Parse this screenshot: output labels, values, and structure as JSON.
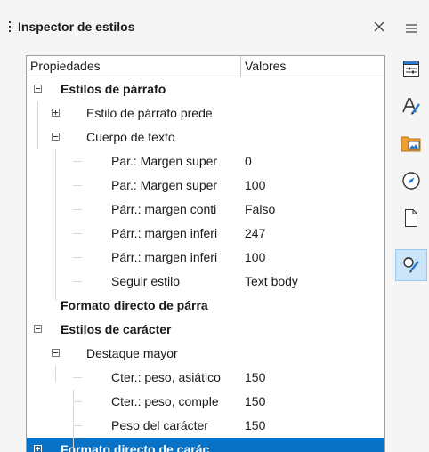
{
  "panel": {
    "title": "Inspector de estilos",
    "close_label": "Cerrar"
  },
  "tree": {
    "columns": [
      "Propiedades",
      "Valores"
    ],
    "rows": [
      {
        "label": "Estilos de párrafo",
        "value": "",
        "level": 0,
        "expander": "minus",
        "bold": true
      },
      {
        "label": "Estilo de párrafo prede",
        "value": "",
        "level": 1,
        "expander": "plus",
        "bold": false
      },
      {
        "label": "Cuerpo de texto",
        "value": "",
        "level": 1,
        "expander": "minus",
        "bold": false
      },
      {
        "label": "Par.: Margen super",
        "value": "0",
        "level": 2,
        "expander": "none",
        "bold": false
      },
      {
        "label": "Par.: Margen super",
        "value": "100",
        "level": 2,
        "expander": "none",
        "bold": false
      },
      {
        "label": "Párr.: margen conti",
        "value": "Falso",
        "level": 2,
        "expander": "none",
        "bold": false
      },
      {
        "label": "Párr.: margen inferi",
        "value": "247",
        "level": 2,
        "expander": "none",
        "bold": false
      },
      {
        "label": "Párr.: margen inferi",
        "value": "100",
        "level": 2,
        "expander": "none",
        "bold": false
      },
      {
        "label": "Seguir estilo",
        "value": "Text body",
        "level": 2,
        "expander": "none",
        "bold": false
      },
      {
        "label": "Formato directo de párra",
        "value": "",
        "level": 0,
        "expander": "none",
        "bold": true
      },
      {
        "label": "Estilos de carácter",
        "value": "",
        "level": 0,
        "expander": "minus",
        "bold": true
      },
      {
        "label": "Destaque mayor",
        "value": "",
        "level": 1,
        "expander": "minus",
        "bold": false
      },
      {
        "label": "Cter.: peso, asiático",
        "value": "150",
        "level": 2,
        "expander": "none",
        "bold": false
      },
      {
        "label": "Cter.: peso, comple",
        "value": "150",
        "level": 2,
        "expander": "none",
        "bold": false
      },
      {
        "label": "Peso del carácter",
        "value": "150",
        "level": 2,
        "expander": "none",
        "bold": false
      },
      {
        "label": "Formato directo de carác",
        "value": "",
        "level": 0,
        "expander": "plus",
        "bold": true,
        "selected": true
      }
    ]
  },
  "sidebar": {
    "buttons": [
      {
        "name": "sidebar-menu-button",
        "icon": "hamburger-icon",
        "active": false
      },
      {
        "name": "sidebar-properties-button",
        "icon": "properties-icon",
        "active": false
      },
      {
        "name": "sidebar-styles-button",
        "icon": "styles-icon",
        "active": false
      },
      {
        "name": "sidebar-gallery-button",
        "icon": "gallery-icon",
        "active": false
      },
      {
        "name": "sidebar-navigator-button",
        "icon": "compass-icon",
        "active": false
      },
      {
        "name": "sidebar-page-button",
        "icon": "page-icon",
        "active": false
      },
      {
        "name": "sidebar-style-inspector-button",
        "icon": "style-inspector-icon",
        "active": true
      }
    ]
  },
  "colors": {
    "selection": "#0a72c5",
    "active_tab": "#cce4f7",
    "accent_blue": "#2b7bd1",
    "folder_orange": "#f0a030"
  }
}
